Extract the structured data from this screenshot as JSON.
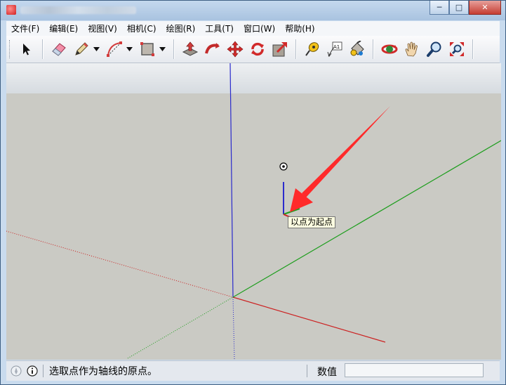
{
  "window": {
    "title": "",
    "controls": {
      "minimize": "─",
      "maximize": "□",
      "close": "✕"
    }
  },
  "menu": [
    {
      "label": "文件(F)"
    },
    {
      "label": "编辑(E)"
    },
    {
      "label": "视图(V)"
    },
    {
      "label": "相机(C)"
    },
    {
      "label": "绘图(R)"
    },
    {
      "label": "工具(T)"
    },
    {
      "label": "窗口(W)"
    },
    {
      "label": "帮助(H)"
    }
  ],
  "toolbar": {
    "tools": [
      {
        "name": "select-icon"
      },
      {
        "name": "eraser-icon"
      },
      {
        "name": "pencil-line-icon"
      },
      {
        "name": "arc-icon"
      },
      {
        "name": "rectangle-icon"
      },
      {
        "name": "push-pull-icon"
      },
      {
        "name": "follow-me-icon"
      },
      {
        "name": "move-icon"
      },
      {
        "name": "rotate-icon"
      },
      {
        "name": "scale-icon"
      },
      {
        "name": "tape-measure-icon"
      },
      {
        "name": "text-icon"
      },
      {
        "name": "paint-bucket-icon"
      },
      {
        "name": "orbit-icon"
      },
      {
        "name": "pan-icon"
      },
      {
        "name": "zoom-icon"
      },
      {
        "name": "zoom-extents-icon"
      }
    ],
    "text_tool_label": "A1"
  },
  "viewport": {
    "tooltip": "以点为起点",
    "colors": {
      "background": "#cacac4",
      "sky": "#e4e8ec",
      "red_axis": "#cc2222",
      "green_axis": "#1e9e1e",
      "blue_axis": "#2a2acc",
      "arrow": "#ff2a2a"
    }
  },
  "status": {
    "text": "选取点作为轴线的原点。",
    "value_label": "数值",
    "value": ""
  }
}
